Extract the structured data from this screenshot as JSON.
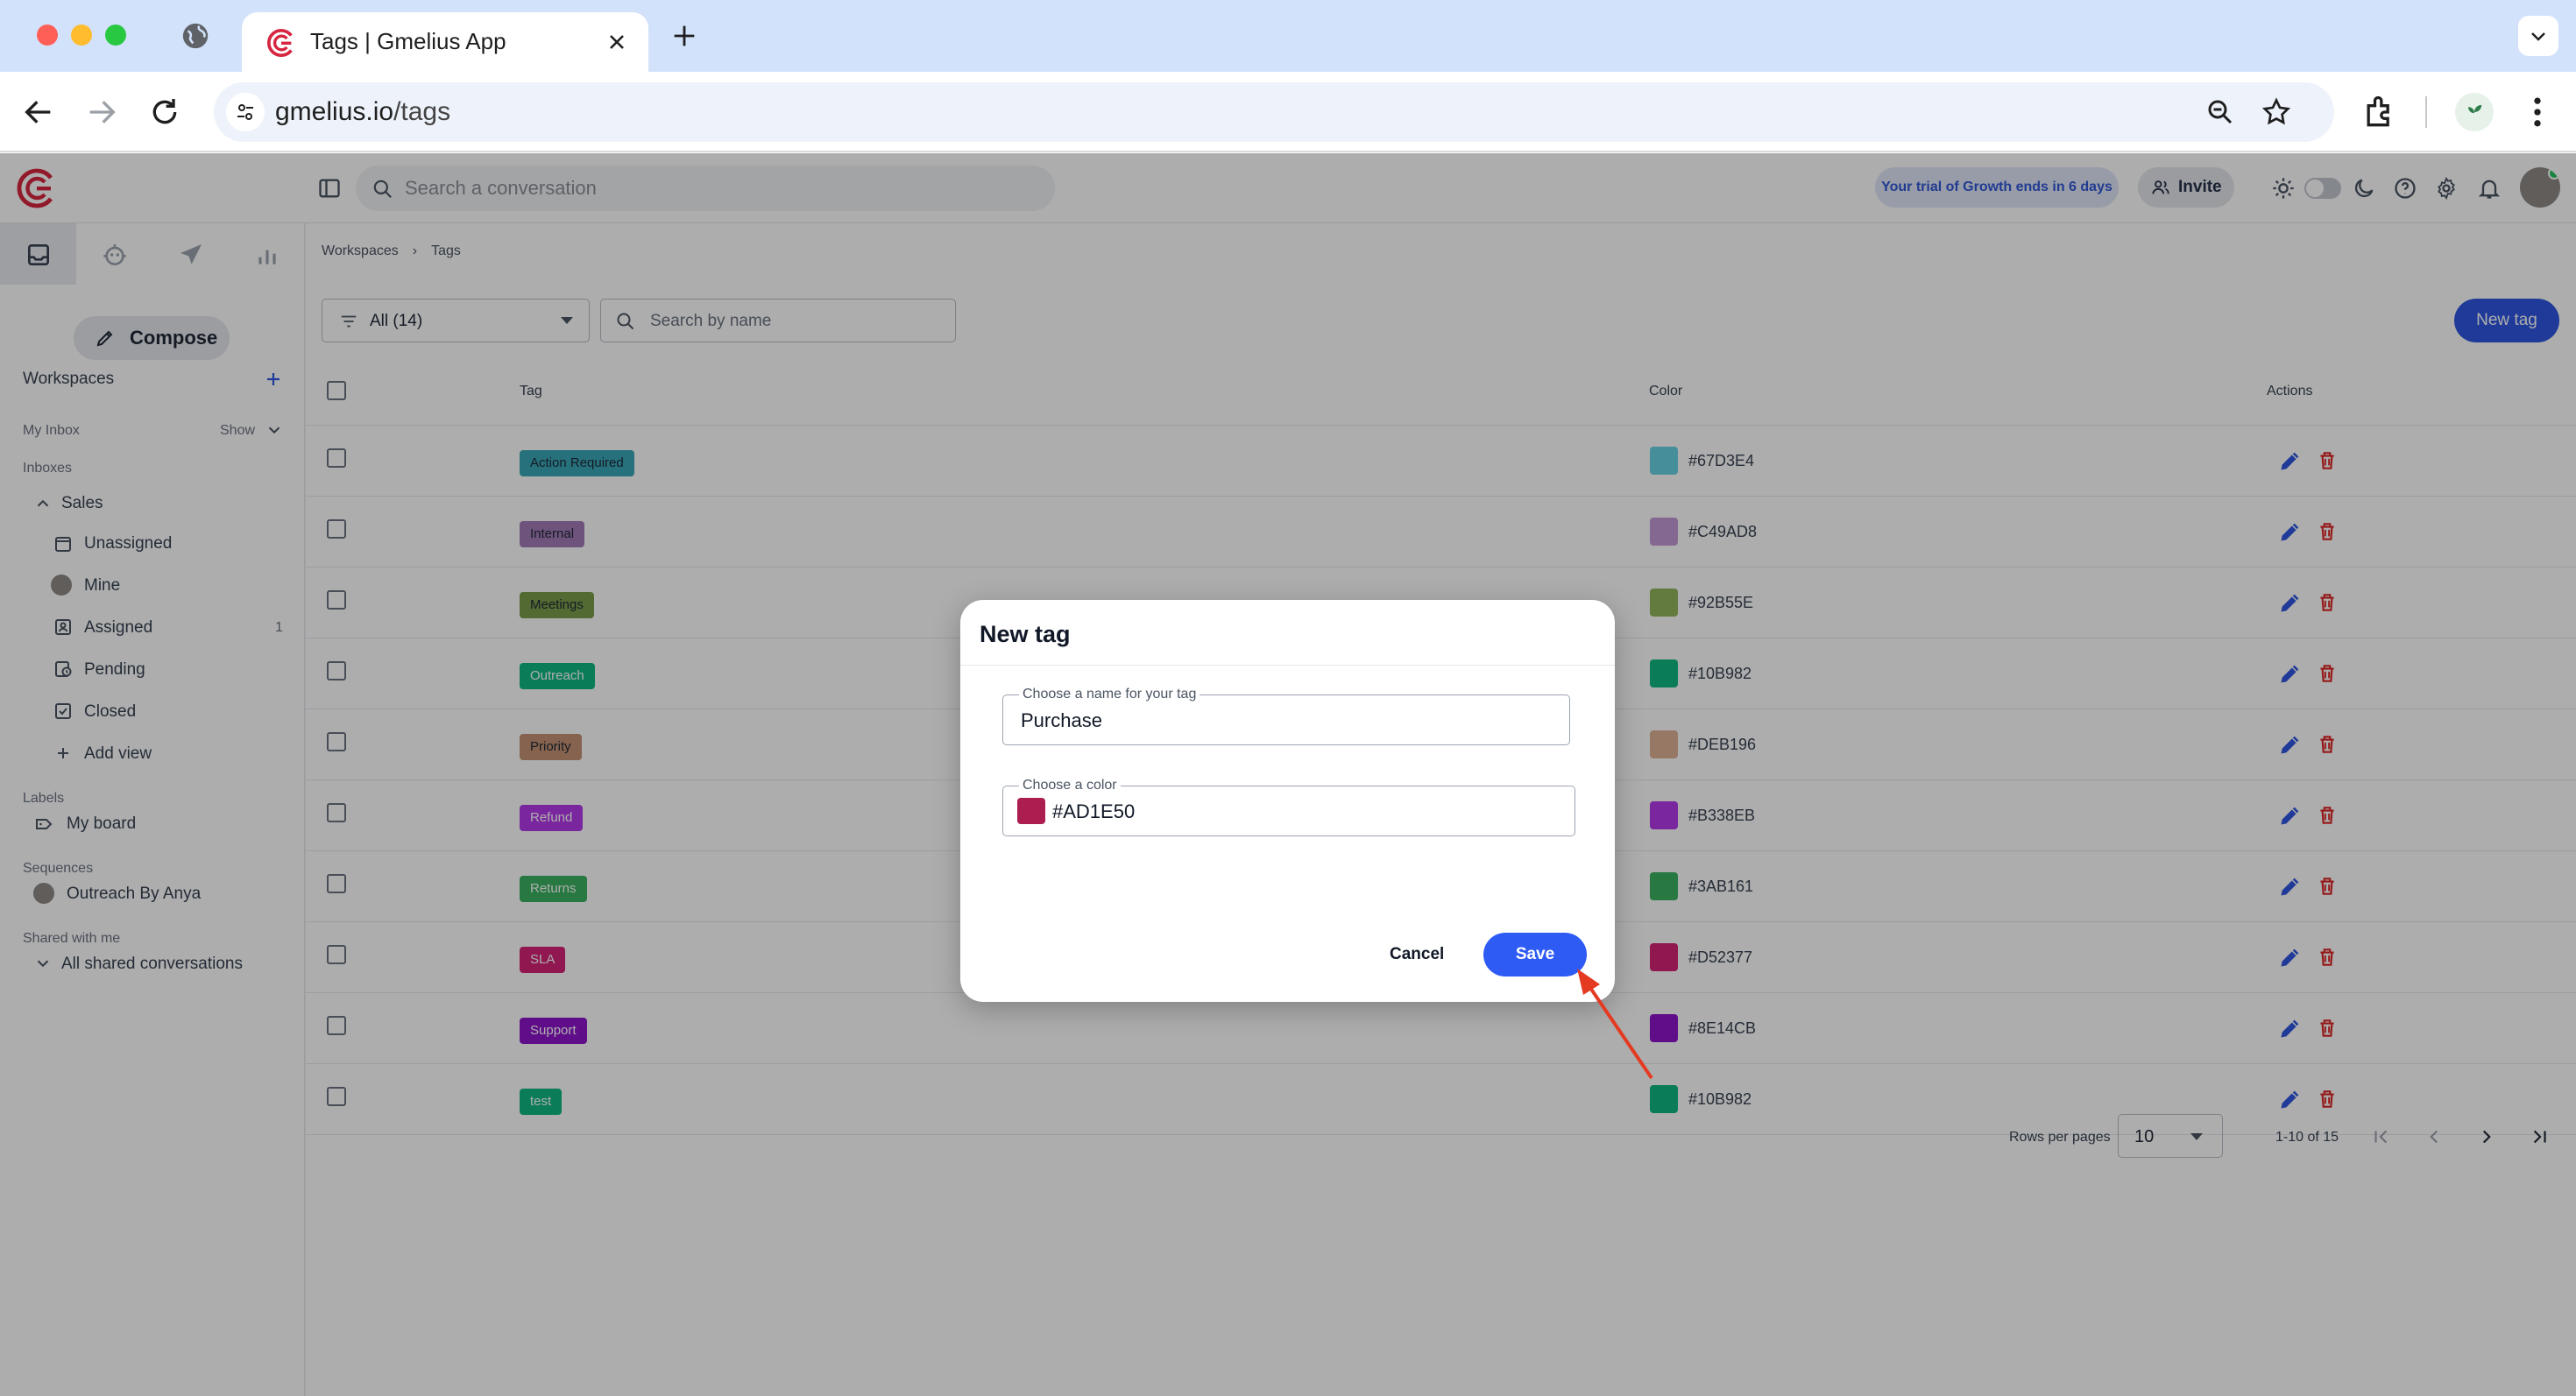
{
  "browser": {
    "tab_title": "Tags | Gmelius App",
    "url_host": "gmelius.io",
    "url_path": "/tags"
  },
  "app": {
    "search_placeholder": "Search a conversation",
    "trial_text": "Your trial of Growth ends in 6 days",
    "invite_label": "Invite"
  },
  "sidebar": {
    "compose_label": "Compose",
    "workspaces_label": "Workspaces",
    "my_inbox_label": "My Inbox",
    "show_label": "Show",
    "inboxes_label": "Inboxes",
    "sales_label": "Sales",
    "items": [
      {
        "label": "Unassigned",
        "icon": "inbox-tray-icon"
      },
      {
        "label": "Mine",
        "icon": "avatar-icon"
      },
      {
        "label": "Assigned",
        "icon": "assigned-icon",
        "count": "1"
      },
      {
        "label": "Pending",
        "icon": "clock-icon"
      },
      {
        "label": "Closed",
        "icon": "check-box-icon"
      },
      {
        "label": "Add view",
        "icon": "plus-icon"
      }
    ],
    "labels_label": "Labels",
    "my_board_label": "My board",
    "sequences_label": "Sequences",
    "sequence_item": "Outreach By Anya",
    "shared_label": "Shared with me",
    "shared_item": "All shared conversations"
  },
  "main": {
    "breadcrumb": [
      "Workspaces",
      "Tags"
    ],
    "filter_value": "All (14)",
    "name_search_placeholder": "Search by name",
    "new_tag_label": "New tag",
    "columns": {
      "tag": "Tag",
      "color": "Color",
      "actions": "Actions"
    },
    "tags": [
      {
        "name": "Action Required",
        "color": "#67D3E4",
        "chip_bg": "#3aa7b7",
        "dark": true
      },
      {
        "name": "Internal",
        "color": "#C49AD8",
        "chip_bg": "#a37bb8",
        "dark": true
      },
      {
        "name": "Meetings",
        "color": "#92B55E",
        "chip_bg": "#7b9c4a",
        "dark": true
      },
      {
        "name": "Outreach",
        "color": "#10B982",
        "chip_bg": "#10B982",
        "dark": false
      },
      {
        "name": "Priority",
        "color": "#DEB196",
        "chip_bg": "#c49273",
        "dark": true
      },
      {
        "name": "Refund",
        "color": "#B338EB",
        "chip_bg": "#B338EB",
        "dark": false
      },
      {
        "name": "Returns",
        "color": "#3AB161",
        "chip_bg": "#3AB161",
        "dark": false
      },
      {
        "name": "SLA",
        "color": "#D52377",
        "chip_bg": "#D52377",
        "dark": false
      },
      {
        "name": "Support",
        "color": "#8E14CB",
        "chip_bg": "#8E14CB",
        "dark": false
      },
      {
        "name": "test",
        "color": "#10B982",
        "chip_bg": "#10B982",
        "dark": false
      }
    ],
    "rows_per_page_label": "Rows per pages",
    "rows_per_page_value": "10",
    "page_range": "1-10 of 15"
  },
  "dialog": {
    "title": "New tag",
    "name_label": "Choose a name for your tag",
    "name_value": "Purchase",
    "color_label": "Choose a color",
    "color_value": "#AD1E50",
    "cancel_label": "Cancel",
    "save_label": "Save"
  },
  "colors": {
    "accent": "#2f56e0",
    "brand": "#d6253f",
    "delete": "#dc2626",
    "annotation_arrow": "#e53a22"
  }
}
